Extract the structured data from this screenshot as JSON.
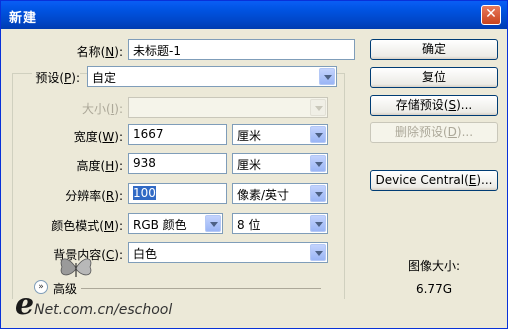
{
  "window": {
    "title": "新建",
    "close_glyph": "✕"
  },
  "form": {
    "name": {
      "label_pre": "名称(",
      "label_key": "N",
      "label_post": "):",
      "value": "未标题-1"
    },
    "preset": {
      "label_pre": "预设(",
      "label_key": "P",
      "label_post": "):",
      "value": "自定"
    },
    "size": {
      "label_pre": "大小(",
      "label_key": "I",
      "label_post": "):",
      "value": ""
    },
    "width": {
      "label_pre": "宽度(",
      "label_key": "W",
      "label_post": "):",
      "value": "1667",
      "unit": "厘米"
    },
    "height": {
      "label_pre": "高度(",
      "label_key": "H",
      "label_post": "):",
      "value": "938",
      "unit": "厘米"
    },
    "resolution": {
      "label_pre": "分辨率(",
      "label_key": "R",
      "label_post": "):",
      "value": "100",
      "unit": "像素/英寸"
    },
    "color_mode": {
      "label_pre": "颜色模式(",
      "label_key": "M",
      "label_post": "):",
      "value": "RGB 颜色",
      "depth": "8 位"
    },
    "background": {
      "label_pre": "背景内容(",
      "label_key": "C",
      "label_post": "):",
      "value": "白色"
    },
    "advanced_label": "高级"
  },
  "buttons": {
    "ok": "确定",
    "reset": "复位",
    "save_preset": {
      "pre": "存储预设(",
      "key": "S",
      "post": ")..."
    },
    "delete_preset": {
      "pre": "删除预设(",
      "key": "D",
      "post": ")..."
    },
    "device_central": {
      "pre": "Device Central(",
      "key": "E",
      "post": ")..."
    }
  },
  "image_size": {
    "label": "图像大小:",
    "value": "6.77G"
  },
  "watermark": {
    "e": "e",
    "rest": "Net.com.cn/eschool"
  },
  "colors": {
    "titlebar": "#0054e3",
    "dialog_bg": "#ece9d8",
    "selection": "#316ac5"
  },
  "icons": [
    "close-icon",
    "dropdown-arrow-icon",
    "expand-chevron-icon",
    "butterfly-logo-icon"
  ]
}
